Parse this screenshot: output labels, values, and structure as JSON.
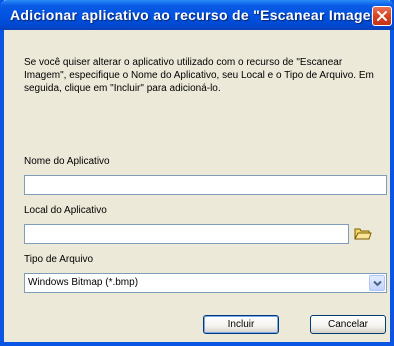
{
  "window": {
    "title": "Adicionar aplicativo ao recurso de \"Escanear Imagem\"",
    "close_icon": "close-icon",
    "accent_color": "#0a55e3"
  },
  "description": "Se você quiser alterar o aplicativo utilizado com o recurso de \"Escanear Imagem\", especifique o Nome do Aplicativo, seu Local e o Tipo de Arquivo. Em seguida, clique em \"Incluir\" para adicioná-lo.",
  "app_name": {
    "label": "Nome do Aplicativo",
    "value": ""
  },
  "app_location": {
    "label": "Local do Aplicativo",
    "value": "",
    "browse_icon": "folder-icon"
  },
  "file_type": {
    "label": "Tipo de Arquivo",
    "selected": "Windows Bitmap (*.bmp)"
  },
  "buttons": {
    "add": "Incluir",
    "cancel": "Cancelar"
  }
}
